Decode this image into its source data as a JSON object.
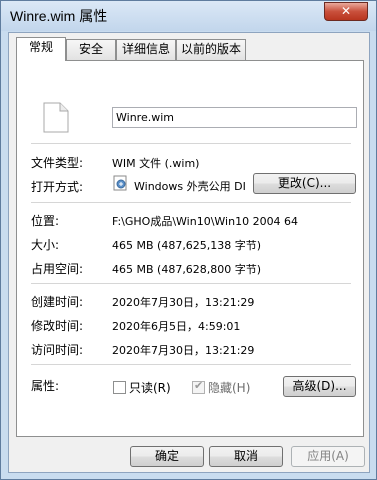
{
  "window": {
    "title": "Winre.wim 属性",
    "close_glyph": "✕"
  },
  "tabs": [
    {
      "label": "常规",
      "active": true
    },
    {
      "label": "安全",
      "active": false
    },
    {
      "label": "详细信息",
      "active": false
    },
    {
      "label": "以前的版本",
      "active": false
    }
  ],
  "general": {
    "file_name": "Winre.wim",
    "file_type_label": "文件类型:",
    "file_type_value": "WIM 文件 (.wim)",
    "opens_with_label": "打开方式:",
    "opens_with_value": "Windows 外壳公用 DI",
    "change_button": "更改(C)...",
    "location_label": "位置:",
    "location_value": "F:\\GHO成品\\Win10\\Win10 2004 64",
    "size_label": "大小:",
    "size_value": "465 MB (487,625,138 字节)",
    "size_on_disk_label": "占用空间:",
    "size_on_disk_value": "465 MB (487,628,800 字节)",
    "created_label": "创建时间:",
    "created_value": "2020年7月30日，13:21:29",
    "modified_label": "修改时间:",
    "modified_value": "2020年6月5日，4:59:01",
    "accessed_label": "访问时间:",
    "accessed_value": "2020年7月30日，13:21:29",
    "attributes_label": "属性:",
    "readonly_label": "只读(R)",
    "readonly_checked": false,
    "hidden_label": "隐藏(H)",
    "hidden_checked": true,
    "advanced_button": "高级(D)..."
  },
  "footer": {
    "ok": "确定",
    "cancel": "取消",
    "apply": "应用(A)"
  }
}
